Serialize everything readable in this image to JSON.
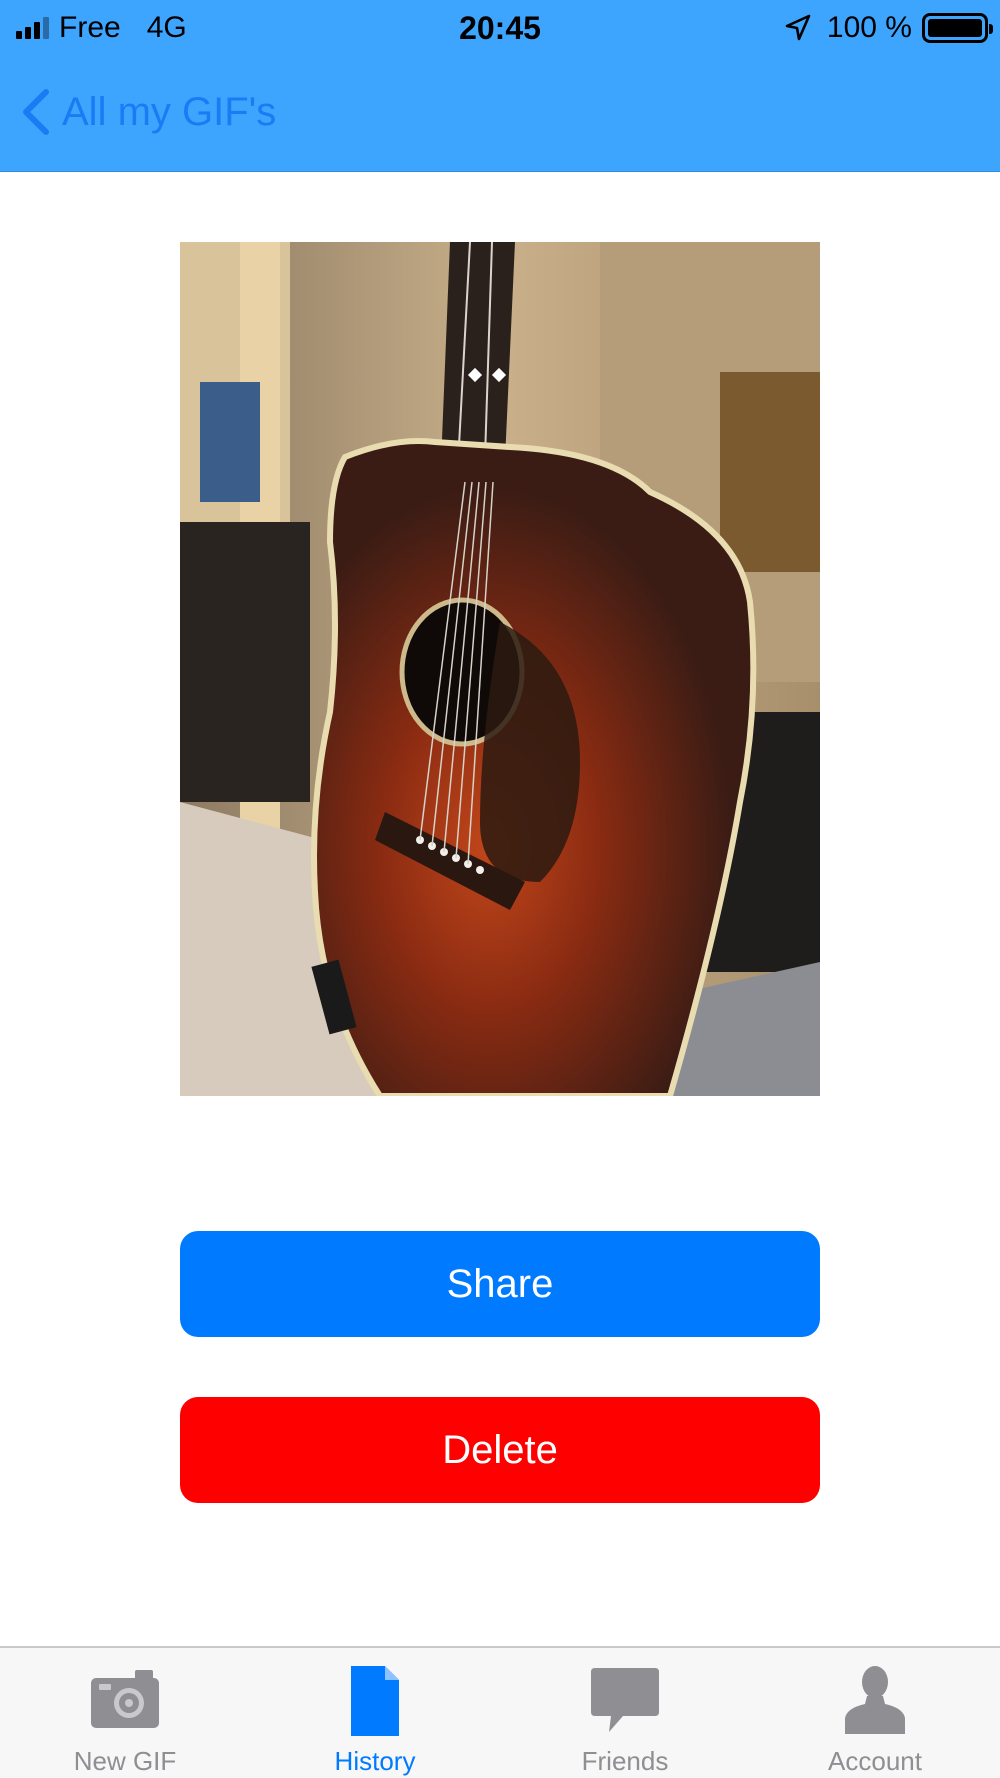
{
  "status_bar": {
    "carrier": "Free",
    "network": "4G",
    "time": "20:45",
    "battery": "100 %"
  },
  "nav": {
    "back_label": "All my GIF's"
  },
  "actions": {
    "share_label": "Share",
    "delete_label": "Delete"
  },
  "tabs": [
    {
      "label": "New GIF",
      "icon": "camera-icon",
      "active": false
    },
    {
      "label": "History",
      "icon": "document-icon",
      "active": true
    },
    {
      "label": "Friends",
      "icon": "chat-bubble-icon",
      "active": false
    },
    {
      "label": "Account",
      "icon": "person-icon",
      "active": false
    }
  ],
  "colors": {
    "header": "#3ea5ff",
    "accent": "#007aff",
    "destructive": "#ff0000",
    "tab_inactive": "#8e8e93"
  }
}
